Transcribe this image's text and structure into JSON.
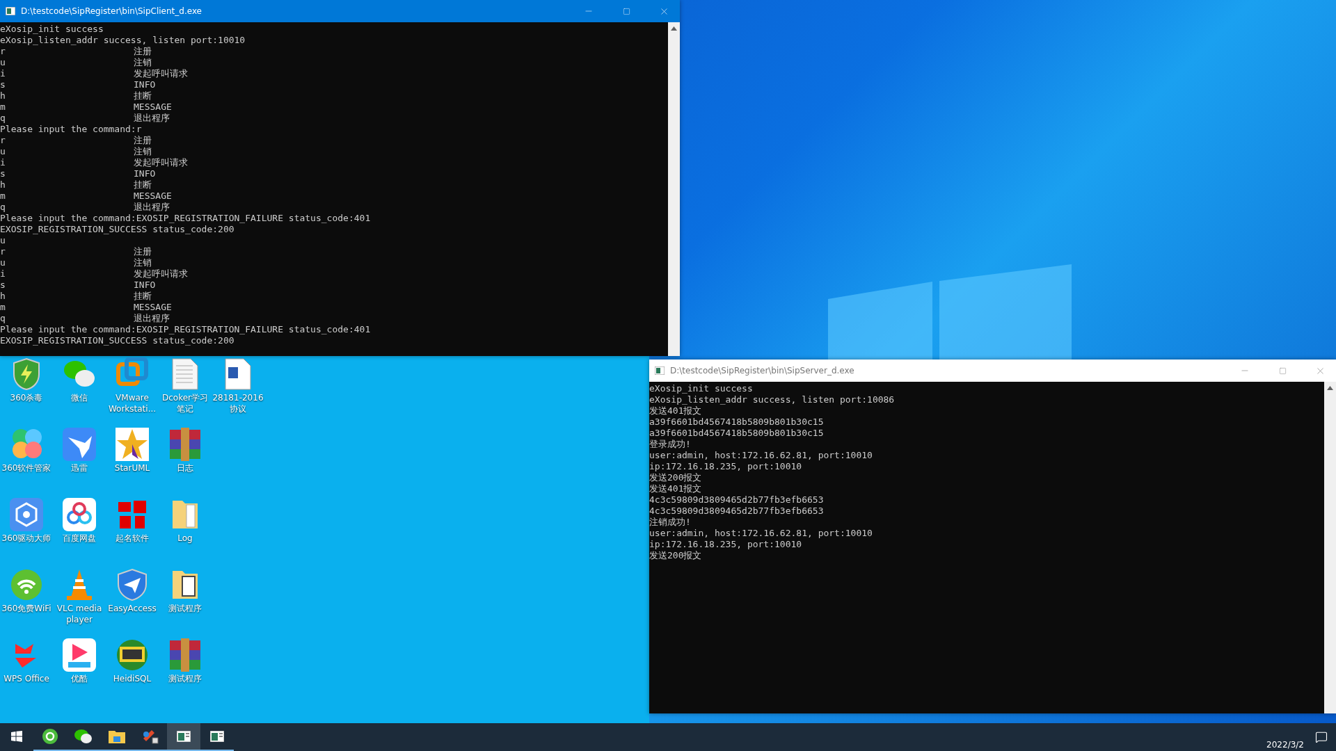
{
  "client_window": {
    "title": "D:\\testcode\\SipRegister\\bin\\SipClient_d.exe",
    "active": true,
    "lines": [
      {
        "kind": "text",
        "text": "eXosip_init success"
      },
      {
        "kind": "text",
        "text": "eXosip_listen_addr success, listen port:10010"
      },
      {
        "kind": "cmd",
        "key": "r",
        "desc": "注册"
      },
      {
        "kind": "cmd",
        "key": "u",
        "desc": "注销"
      },
      {
        "kind": "cmd",
        "key": "i",
        "desc": "发起呼叫请求"
      },
      {
        "kind": "cmd",
        "key": "s",
        "desc": "INFO"
      },
      {
        "kind": "cmd",
        "key": "h",
        "desc": "挂断"
      },
      {
        "kind": "cmd",
        "key": "m",
        "desc": "MESSAGE"
      },
      {
        "kind": "cmd",
        "key": "q",
        "desc": "退出程序"
      },
      {
        "kind": "text",
        "text": "Please input the command:r"
      },
      {
        "kind": "cmd",
        "key": "r",
        "desc": "注册"
      },
      {
        "kind": "cmd",
        "key": "u",
        "desc": "注销"
      },
      {
        "kind": "cmd",
        "key": "i",
        "desc": "发起呼叫请求"
      },
      {
        "kind": "cmd",
        "key": "s",
        "desc": "INFO"
      },
      {
        "kind": "cmd",
        "key": "h",
        "desc": "挂断"
      },
      {
        "kind": "cmd",
        "key": "m",
        "desc": "MESSAGE"
      },
      {
        "kind": "cmd",
        "key": "q",
        "desc": "退出程序"
      },
      {
        "kind": "text",
        "text": "Please input the command:EXOSIP_REGISTRATION_FAILURE status_code:401"
      },
      {
        "kind": "text",
        "text": "EXOSIP_REGISTRATION_SUCCESS status_code:200"
      },
      {
        "kind": "text",
        "text": "u"
      },
      {
        "kind": "cmd",
        "key": "r",
        "desc": "注册"
      },
      {
        "kind": "cmd",
        "key": "u",
        "desc": "注销"
      },
      {
        "kind": "cmd",
        "key": "i",
        "desc": "发起呼叫请求"
      },
      {
        "kind": "cmd",
        "key": "s",
        "desc": "INFO"
      },
      {
        "kind": "cmd",
        "key": "h",
        "desc": "挂断"
      },
      {
        "kind": "cmd",
        "key": "m",
        "desc": "MESSAGE"
      },
      {
        "kind": "cmd",
        "key": "q",
        "desc": "退出程序"
      },
      {
        "kind": "text",
        "text": "Please input the command:EXOSIP_REGISTRATION_FAILURE status_code:401"
      },
      {
        "kind": "text",
        "text": "EXOSIP_REGISTRATION_SUCCESS status_code:200"
      }
    ]
  },
  "desktop_icons": [
    {
      "label": "360杀毒"
    },
    {
      "label": "360软件管家"
    },
    {
      "label": "360驱动大师"
    },
    {
      "label": "360免费WiFi"
    },
    {
      "label": "WPS Office"
    },
    {
      "label": "微信"
    },
    {
      "label": "迅雷"
    },
    {
      "label": "百度网盘"
    },
    {
      "label": "VLC media player"
    },
    {
      "label": "优酷"
    },
    {
      "label": "VMware Workstati..."
    },
    {
      "label": "StarUML"
    },
    {
      "label": "起名软件"
    },
    {
      "label": "EasyAccess"
    },
    {
      "label": "HeidiSQL"
    },
    {
      "label": "Dcoker学习笔记"
    },
    {
      "label": "日志"
    },
    {
      "label": "Log"
    },
    {
      "label": "测试程序"
    },
    {
      "label": "测试程序"
    },
    {
      "label": "28181-2016协议"
    }
  ],
  "server_window": {
    "title": "D:\\testcode\\SipRegister\\bin\\SipServer_d.exe",
    "active": false,
    "lines": [
      {
        "kind": "text",
        "text": "eXosip_init success"
      },
      {
        "kind": "text",
        "text": "eXosip_listen_addr success, listen port:10086"
      },
      {
        "kind": "text",
        "text": "发送401报文"
      },
      {
        "kind": "text",
        "text": "a39f6601bd4567418b5809b801b30c15"
      },
      {
        "kind": "text",
        "text": "a39f6601bd4567418b5809b801b30c15"
      },
      {
        "kind": "text",
        "text": "登录成功!"
      },
      {
        "kind": "text",
        "text": "user:admin, host:172.16.62.81, port:10010"
      },
      {
        "kind": "text",
        "text": "ip:172.16.18.235, port:10010"
      },
      {
        "kind": "text",
        "text": "发送200报文"
      },
      {
        "kind": "text",
        "text": "发送401报文"
      },
      {
        "kind": "text",
        "text": "4c3c59809d3809465d2b77fb3efb6653"
      },
      {
        "kind": "text",
        "text": "4c3c59809d3809465d2b77fb3efb6653"
      },
      {
        "kind": "text",
        "text": "注销成功!"
      },
      {
        "kind": "text",
        "text": "user:admin, host:172.16.62.81, port:10010"
      },
      {
        "kind": "text",
        "text": "ip:172.16.18.235, port:10010"
      },
      {
        "kind": "text",
        "text": "发送200报文"
      }
    ]
  },
  "taskbar": {
    "items": [
      {
        "selected": false
      },
      {
        "selected": false
      },
      {
        "selected": false
      },
      {
        "selected": false
      },
      {
        "selected": false
      },
      {
        "selected": true
      },
      {
        "selected": false
      }
    ],
    "date": "2022/3/2"
  }
}
